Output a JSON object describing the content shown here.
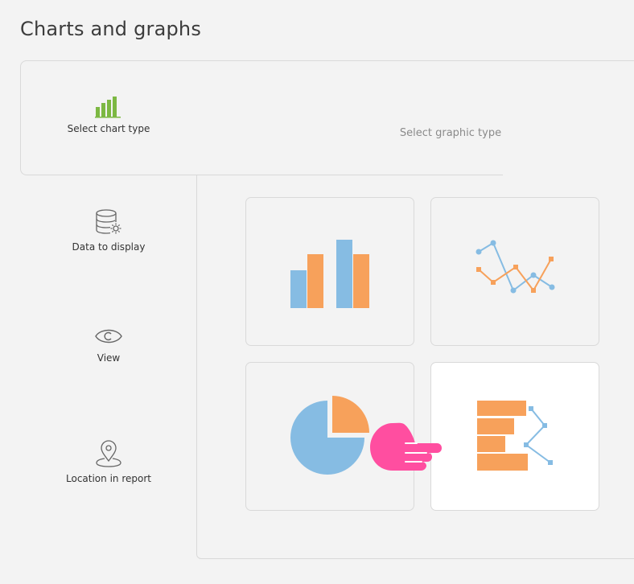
{
  "page": {
    "title": "Charts and graphs"
  },
  "steps": [
    {
      "label": "Select chart type",
      "icon": "bar-chart-icon",
      "active": true
    },
    {
      "label": "Data to display",
      "icon": "database-settings-icon"
    },
    {
      "label": "View",
      "icon": "eye-icon"
    },
    {
      "label": "Location in report",
      "icon": "map-pin-icon"
    }
  ],
  "main": {
    "heading": "Select graphic type",
    "tiles": [
      {
        "type": "bar",
        "icon": "column-chart-icon",
        "selected": false
      },
      {
        "type": "line",
        "icon": "line-chart-icon",
        "selected": false
      },
      {
        "type": "pie",
        "icon": "pie-chart-icon",
        "selected": false
      },
      {
        "type": "bar-line",
        "icon": "horizontal-bar-line-chart-icon",
        "selected": true
      }
    ]
  },
  "colors": {
    "orange": "#f7a15b",
    "blue": "#86bce3",
    "green": "#7cb842",
    "pointer": "#ff4ea0"
  },
  "overlay": {
    "icon": "pointing-hand-icon"
  }
}
